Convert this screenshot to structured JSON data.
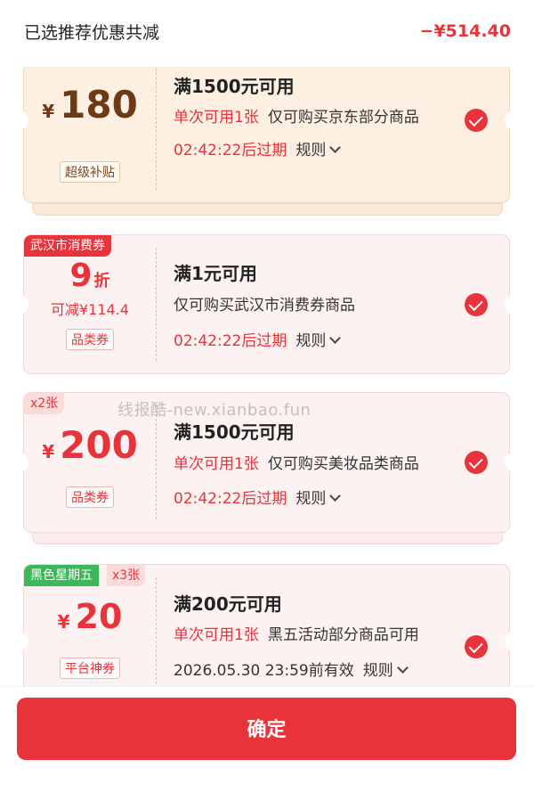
{
  "header": {
    "title": "已选推荐优惠共减",
    "total": "−¥514.40"
  },
  "coupons": [
    {
      "currency": "¥",
      "amount": "180",
      "tag": "超级补贴",
      "threshold": "满1500元可用",
      "limit": "单次可用1张",
      "scope": "仅可购买京东部分商品",
      "expire": "02:42:22后过期",
      "rule": "规则",
      "selected": true
    },
    {
      "corner_tag": "武汉市消费券",
      "amount": "9",
      "amount_suffix": "折",
      "subline": "可减¥114.4",
      "tag": "品类券",
      "threshold": "满1元可用",
      "scope": "仅可购买武汉市消费券商品",
      "expire": "02:42:22后过期",
      "rule": "规则",
      "selected": true
    },
    {
      "corner_tag": "x2张",
      "currency": "¥",
      "amount": "200",
      "tag": "品类券",
      "threshold": "满1500元可用",
      "limit": "单次可用1张",
      "scope": "仅可购买美妆品类商品",
      "expire": "02:42:22后过期",
      "rule": "规则",
      "selected": true
    },
    {
      "corner_tag": "黑色星期五",
      "corner_tag2": "x3张",
      "currency": "¥",
      "amount": "20",
      "tag": "平台神券",
      "threshold": "满200元可用",
      "limit": "单次可用1张",
      "scope": "黑五活动部分商品可用",
      "expire": "2026.05.30 23:59前有效",
      "rule": "规则",
      "selected": true
    }
  ],
  "watermark": "线报酷-new.xianbao.fun",
  "footer": {
    "confirm_label": "确定"
  },
  "colors": {
    "accent": "#e8333a",
    "green_tag": "#3cb85a"
  }
}
